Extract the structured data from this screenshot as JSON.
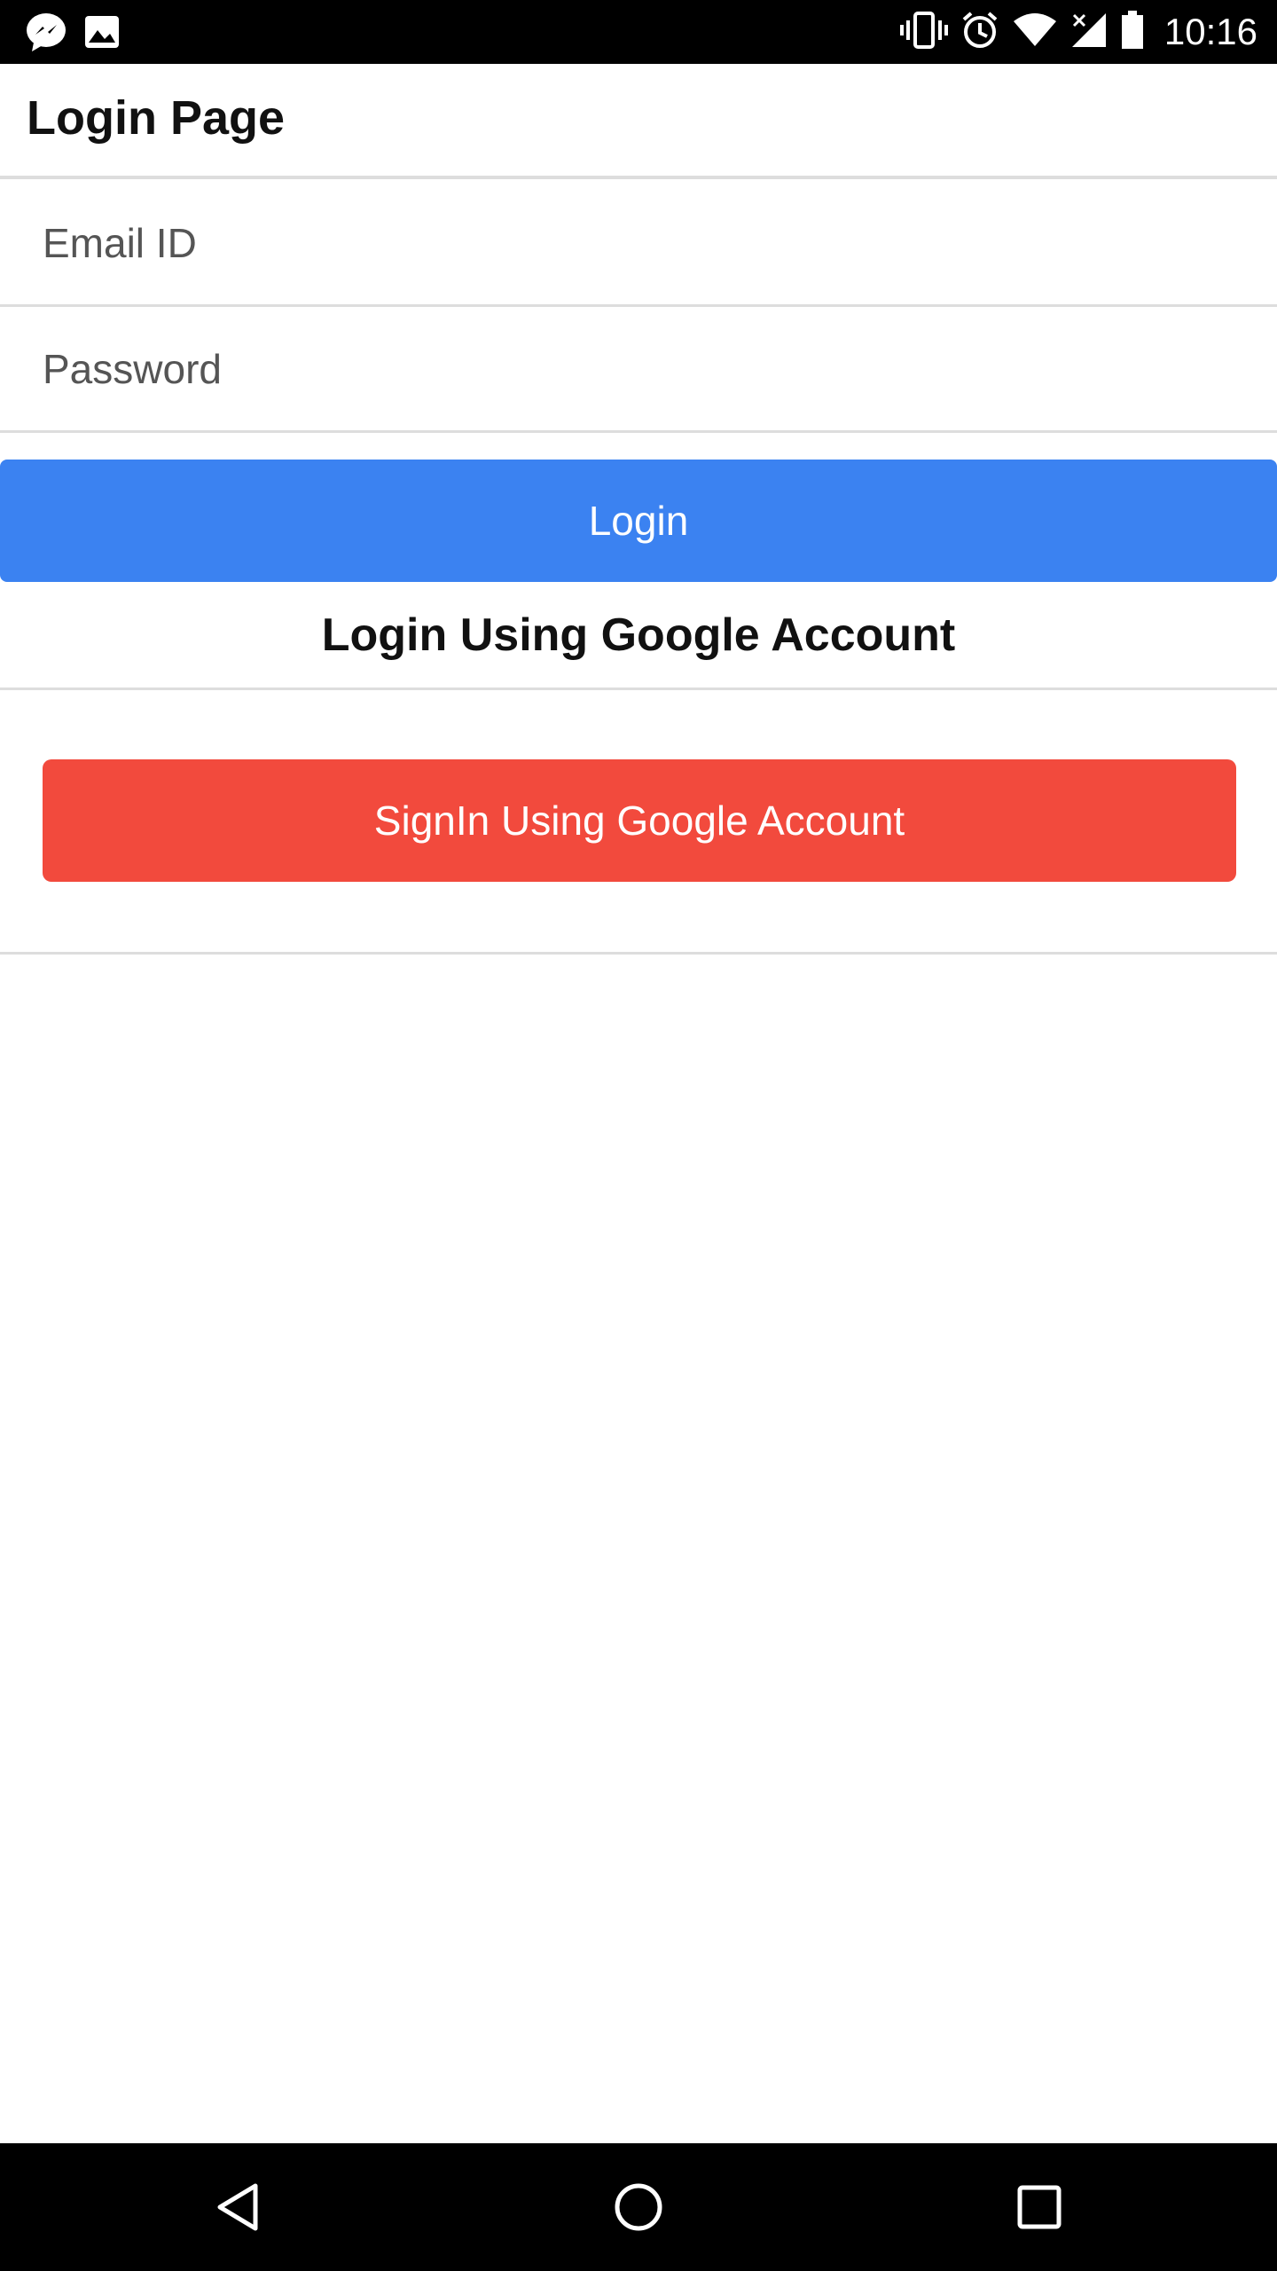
{
  "status_bar": {
    "left_icons": [
      "messenger-icon",
      "image-icon"
    ],
    "right_icons": [
      "vibrate-icon",
      "alarm-icon",
      "wifi-icon",
      "signal-icon",
      "battery-icon"
    ],
    "time": "10:16"
  },
  "app_bar": {
    "title": "Login Page"
  },
  "form": {
    "email": {
      "placeholder": "Email ID",
      "value": ""
    },
    "password": {
      "placeholder": "Password",
      "value": ""
    },
    "login_label": "Login"
  },
  "google_section": {
    "heading": "Login Using Google Account",
    "button_label": "SignIn Using Google Account"
  },
  "nav_bar": {
    "icons": [
      "back-icon",
      "home-icon",
      "recents-icon"
    ]
  },
  "colors": {
    "login_button": "#3b82f1",
    "google_button": "#f24a3d",
    "status_bar": "#000000",
    "divider": "#dddddd"
  }
}
